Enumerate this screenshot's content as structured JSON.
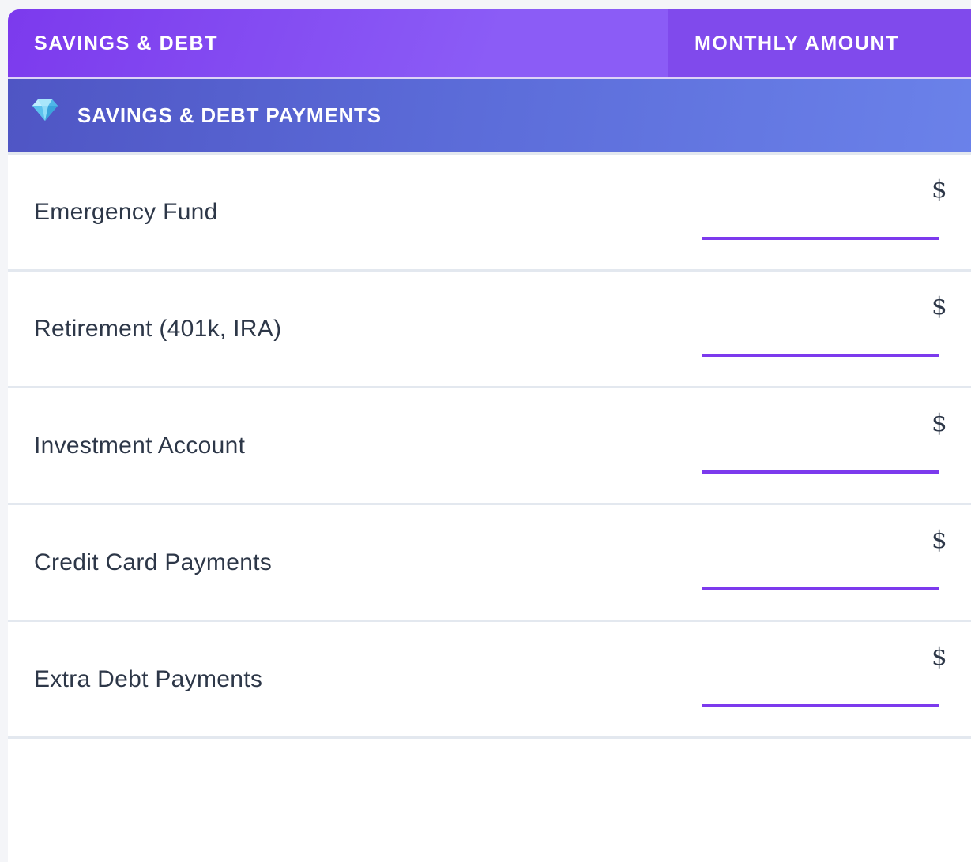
{
  "table": {
    "header": {
      "category_label": "SAVINGS & DEBT",
      "amount_label": "MONTHLY AMOUNT"
    },
    "section": {
      "icon": "gem-icon",
      "title": "SAVINGS & DEBT PAYMENTS"
    },
    "currency_symbol": "$",
    "rows": [
      {
        "label": "Emergency Fund",
        "value": ""
      },
      {
        "label": "Retirement (401k, IRA)",
        "value": ""
      },
      {
        "label": "Investment Account",
        "value": ""
      },
      {
        "label": "Credit Card Payments",
        "value": ""
      },
      {
        "label": "Extra Debt Payments",
        "value": ""
      }
    ]
  },
  "colors": {
    "header_gradient_start": "#7c3aed",
    "header_gradient_end": "#8b5cf6",
    "section_gradient_start": "#4f55c4",
    "section_gradient_end": "#6b82ea",
    "input_underline": "#7c3aed",
    "text": "#2d3748",
    "divider": "#e3e8ef"
  }
}
